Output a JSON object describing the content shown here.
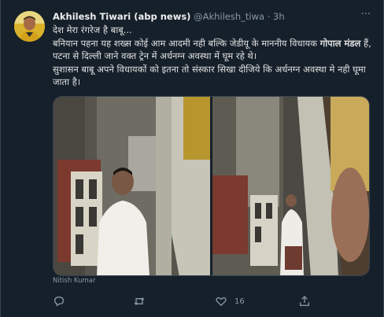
{
  "tweet": {
    "author_name": "Akhilesh Tiwari (abp news)",
    "author_handle": "@Akhilesh_tiwa",
    "separator": "·",
    "time": "3h",
    "more_icon": "more-horizontal-icon",
    "text_line1": "देश मेरा रंगरेज है बाबू...",
    "text_line2_a": "बनियान पहना यह शख्स कोई आम आदमी नही बल्कि जेडीयू के माननीय विधायक ",
    "text_line2_bold": "गोपाल मंडल",
    "text_line2_b": " हैं, पटना से दिल्ली जाने वक्त ट्रेन में अर्धनग्न अवस्था में घूम रहे थे।",
    "text_line3": "सुशासन बाबू अपने विधायकों को इतना तो संस्कार सिखा दीजिये कि अर्धनग्न अवस्था मे नही घूमा जाता है।",
    "tagged_person": "Nitish Kumar"
  },
  "actions": {
    "reply_icon": "reply-icon",
    "retweet_icon": "retweet-icon",
    "like_icon": "heart-icon",
    "like_count": "16",
    "share_icon": "share-icon"
  },
  "colors": {
    "background": "#15202b",
    "text": "#d9d9d9",
    "secondary_text": "#8899a6",
    "border": "#38444d"
  }
}
